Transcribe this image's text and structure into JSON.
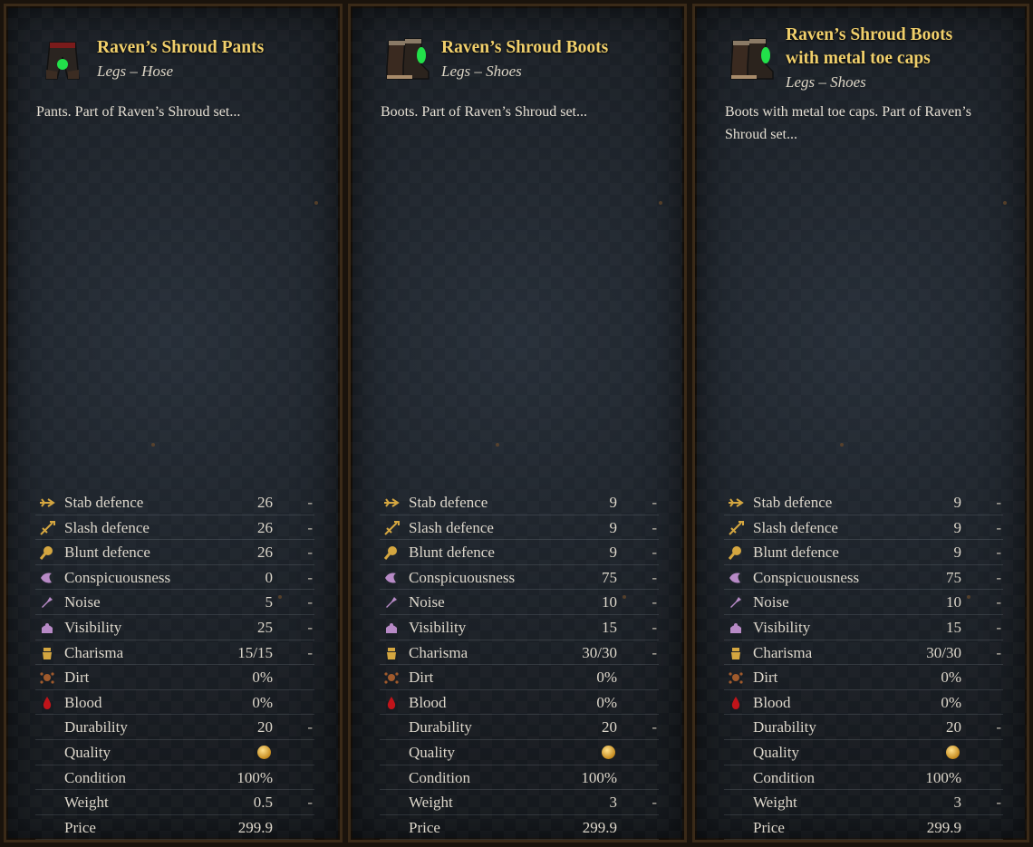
{
  "colors": {
    "title": "#f0cf6b",
    "text": "#ddd7cb",
    "frame": "#3a2a18"
  },
  "panels": [
    {
      "icon": "pants-icon",
      "title_lines": [
        "Raven’s Shroud Pants"
      ],
      "subtitle": "Legs – Hose",
      "description": "Pants. Part of Raven’s Shroud set...",
      "stats": [
        {
          "icon": "stab-icon",
          "label": "Stab defence",
          "value": "26",
          "dash": "-"
        },
        {
          "icon": "slash-icon",
          "label": "Slash defence",
          "value": "26",
          "dash": "-"
        },
        {
          "icon": "blunt-icon",
          "label": "Blunt defence",
          "value": "26",
          "dash": "-"
        },
        {
          "icon": "conspicuousness-icon",
          "label": "Conspicuousness",
          "value": "0",
          "dash": "-"
        },
        {
          "icon": "noise-icon",
          "label": "Noise",
          "value": "5",
          "dash": "-"
        },
        {
          "icon": "visibility-icon",
          "label": "Visibility",
          "value": "25",
          "dash": "-"
        },
        {
          "icon": "charisma-icon",
          "label": "Charisma",
          "value": "15/15",
          "dash": "-"
        },
        {
          "icon": "dirt-icon",
          "label": "Dirt",
          "value": "0%",
          "dash": ""
        },
        {
          "icon": "blood-icon",
          "label": "Blood",
          "value": "0%",
          "dash": ""
        },
        {
          "icon": "",
          "label": "Durability",
          "value": "20",
          "dash": "-"
        },
        {
          "icon": "",
          "label": "Quality",
          "value": "coin",
          "dash": ""
        },
        {
          "icon": "",
          "label": "Condition",
          "value": "100%",
          "dash": ""
        },
        {
          "icon": "",
          "label": "Weight",
          "value": "0.5",
          "dash": "-"
        },
        {
          "icon": "",
          "label": "Price",
          "value": "299.9",
          "dash": ""
        }
      ]
    },
    {
      "icon": "boots-icon",
      "title_lines": [
        "Raven’s Shroud Boots"
      ],
      "subtitle": "Legs – Shoes",
      "description": "Boots. Part of Raven’s Shroud set...",
      "stats": [
        {
          "icon": "stab-icon",
          "label": "Stab defence",
          "value": "9",
          "dash": "-"
        },
        {
          "icon": "slash-icon",
          "label": "Slash defence",
          "value": "9",
          "dash": "-"
        },
        {
          "icon": "blunt-icon",
          "label": "Blunt defence",
          "value": "9",
          "dash": "-"
        },
        {
          "icon": "conspicuousness-icon",
          "label": "Conspicuousness",
          "value": "75",
          "dash": "-"
        },
        {
          "icon": "noise-icon",
          "label": "Noise",
          "value": "10",
          "dash": "-"
        },
        {
          "icon": "visibility-icon",
          "label": "Visibility",
          "value": "15",
          "dash": "-"
        },
        {
          "icon": "charisma-icon",
          "label": "Charisma",
          "value": "30/30",
          "dash": "-"
        },
        {
          "icon": "dirt-icon",
          "label": "Dirt",
          "value": "0%",
          "dash": ""
        },
        {
          "icon": "blood-icon",
          "label": "Blood",
          "value": "0%",
          "dash": ""
        },
        {
          "icon": "",
          "label": "Durability",
          "value": "20",
          "dash": "-"
        },
        {
          "icon": "",
          "label": "Quality",
          "value": "coin",
          "dash": ""
        },
        {
          "icon": "",
          "label": "Condition",
          "value": "100%",
          "dash": ""
        },
        {
          "icon": "",
          "label": "Weight",
          "value": "3",
          "dash": "-"
        },
        {
          "icon": "",
          "label": "Price",
          "value": "299.9",
          "dash": ""
        }
      ]
    },
    {
      "icon": "boots-icon",
      "title_lines": [
        "Raven’s Shroud Boots",
        "with metal toe caps"
      ],
      "subtitle": "Legs – Shoes",
      "description": "Boots with metal toe caps. Part of Raven’s Shroud set...",
      "stats": [
        {
          "icon": "stab-icon",
          "label": "Stab defence",
          "value": "9",
          "dash": "-"
        },
        {
          "icon": "slash-icon",
          "label": "Slash defence",
          "value": "9",
          "dash": "-"
        },
        {
          "icon": "blunt-icon",
          "label": "Blunt defence",
          "value": "9",
          "dash": "-"
        },
        {
          "icon": "conspicuousness-icon",
          "label": "Conspicuousness",
          "value": "75",
          "dash": "-"
        },
        {
          "icon": "noise-icon",
          "label": "Noise",
          "value": "10",
          "dash": "-"
        },
        {
          "icon": "visibility-icon",
          "label": "Visibility",
          "value": "15",
          "dash": "-"
        },
        {
          "icon": "charisma-icon",
          "label": "Charisma",
          "value": "30/30",
          "dash": "-"
        },
        {
          "icon": "dirt-icon",
          "label": "Dirt",
          "value": "0%",
          "dash": ""
        },
        {
          "icon": "blood-icon",
          "label": "Blood",
          "value": "0%",
          "dash": ""
        },
        {
          "icon": "",
          "label": "Durability",
          "value": "20",
          "dash": "-"
        },
        {
          "icon": "",
          "label": "Quality",
          "value": "coin",
          "dash": ""
        },
        {
          "icon": "",
          "label": "Condition",
          "value": "100%",
          "dash": ""
        },
        {
          "icon": "",
          "label": "Weight",
          "value": "3",
          "dash": "-"
        },
        {
          "icon": "",
          "label": "Price",
          "value": "299.9",
          "dash": ""
        }
      ]
    }
  ]
}
